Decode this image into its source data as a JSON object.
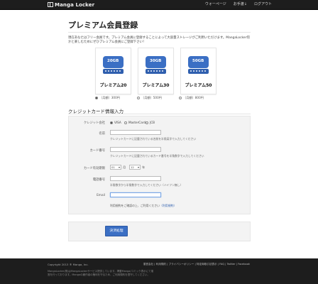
{
  "header": {
    "logo_text": "Manga Locker",
    "nav": [
      "ウォーページ",
      "お手渡↓",
      "ログアウト"
    ]
  },
  "page": {
    "title": "プレミアム会員登録",
    "description": "現在あなたはフリー会員です。プレミアム会員に登録することによって大容量ストレージがご利用いただけます。MangaLocker何かと楽しむためにぜひプレミアム会員にご登録下さい！"
  },
  "plans": [
    {
      "cap": "20GB",
      "name": "プレミアム20",
      "price": "（月額）300円",
      "color": "#3b6fc4"
    },
    {
      "cap": "30GB",
      "name": "プレミアム30",
      "price": "（月額）500円",
      "color": "#3b6fc4"
    },
    {
      "cap": "50GB",
      "name": "プレミアム50",
      "price": "（月額）800円",
      "color": "#3b6fc4"
    }
  ],
  "form": {
    "section_title": "クレジットカード情報入力",
    "card_company_label": "クレジット会社",
    "card_options": [
      "VISA",
      "MasterCard",
      "JCB"
    ],
    "name_label": "名前",
    "name_hint": "クレジットカードに記載されている名前を半角英字で入力してください",
    "number_label": "カード番号",
    "number_hint": "クレジットカードに記載されているカード番号を半角数字で入力してください",
    "expiry_label": "カード有効期限",
    "expiry_month": "01",
    "expiry_month_unit": "月",
    "expiry_year": "12",
    "expiry_year_unit": "年",
    "phone_label": "電話番号",
    "phone_hint": "半角数字から半角数字で入力してください（ハイフン無し）",
    "email_label": "Email",
    "note_prefix": "利用規約をご確認の上、ご利用ください",
    "note_link": "（利用規約）",
    "submit_label": "決済処理"
  },
  "footer": {
    "copyright": "Copyright 2013 ® Manga, Inc.",
    "legal": "MangaLocker(株)はMangaLockerサービス提供しています。掲載Manga/コミック表示にて運営を行っております。Mangaの著作者の権利を守るため、ご利用規約を遵守してください。",
    "links": "運営会社 | 利用規約 | プライバシーポリシー | 特定商取引法表示 | FAQ | Twitter | Facebook"
  }
}
